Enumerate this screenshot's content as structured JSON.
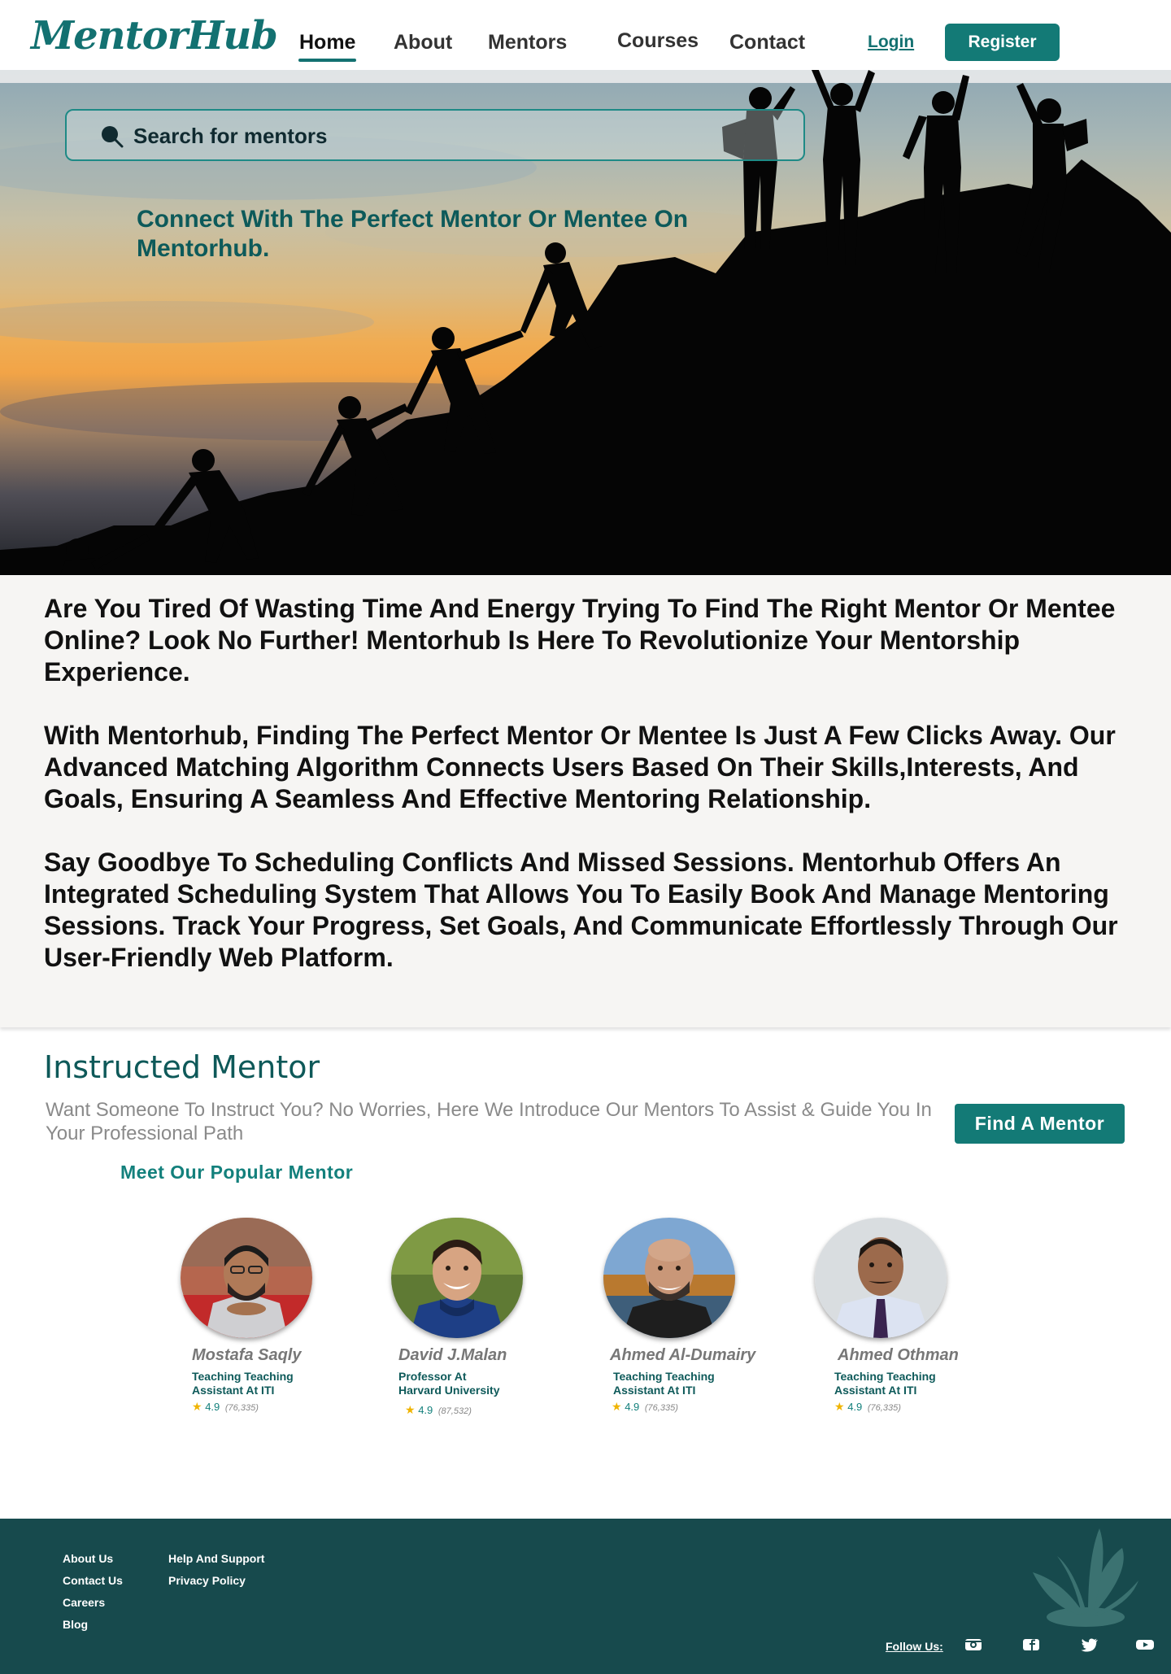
{
  "brand": {
    "logo_text": "MentorHub",
    "accent_color": "#137a76",
    "footer_color": "#174a4d"
  },
  "nav": {
    "links": [
      "Home",
      "About",
      "Mentors",
      "Courses",
      "Contact"
    ],
    "active": "Home",
    "login": "Login",
    "register": "Register"
  },
  "hero": {
    "search_placeholder": "Search for  mentors",
    "tagline": "Connect With The Perfect Mentor Or Mentee On Mentorhub."
  },
  "intro": {
    "paragraphs": [
      "Are You Tired Of Wasting Time And Energy Trying To Find The Right Mentor Or Mentee Online? Look No Further! Mentorhub Is Here To Revolutionize Your Mentorship Experience.",
      "With Mentorhub, Finding The Perfect Mentor Or Mentee Is Just A Few Clicks Away. Our Advanced Matching Algorithm Connects Users Based On Their Skills,Interests, And Goals, Ensuring A Seamless And Effective Mentoring Relationship.",
      "Say Goodbye To Scheduling Conflicts And Missed Sessions. Mentorhub Offers An Integrated Scheduling System That Allows You To Easily Book And Manage Mentoring Sessions. Track Your Progress, Set Goals, And Communicate Effortlessly Through Our User-Friendly Web Platform."
    ]
  },
  "mentors_section": {
    "title": "Instructed Mentor",
    "subtitle": "Want Someone To Instruct You? No Worries, Here We Introduce Our Mentors To Assist & Guide You In Your Professional  Path",
    "find_button": "Find A Mentor",
    "popular_title": "Meet Our Popular Mentor",
    "mentors": [
      {
        "name": "Mostafa Saqly",
        "role": "Teaching Teaching Assistant At ITI",
        "rating": "4.9",
        "reviews": "(76,335)"
      },
      {
        "name": "David J.Malan",
        "role": "Professor At Harvard University",
        "rating": "4.9",
        "reviews": "(87,532)"
      },
      {
        "name": "Ahmed Al-Dumairy",
        "role": "Teaching Teaching Assistant At ITI",
        "rating": "4.9",
        "reviews": "(76,335)"
      },
      {
        "name": "Ahmed Othman",
        "role": "Teaching Teaching Assistant At ITI",
        "rating": "4.9",
        "reviews": "(76,335)"
      }
    ]
  },
  "footer": {
    "col1": [
      "About Us",
      "Contact Us",
      "Careers",
      "Blog"
    ],
    "col2": [
      "Help And Support",
      "Privacy Policy"
    ],
    "follow_label": "Follow Us:",
    "social_icons": [
      "instagram-icon",
      "facebook-icon",
      "twitter-icon",
      "youtube-icon"
    ]
  }
}
